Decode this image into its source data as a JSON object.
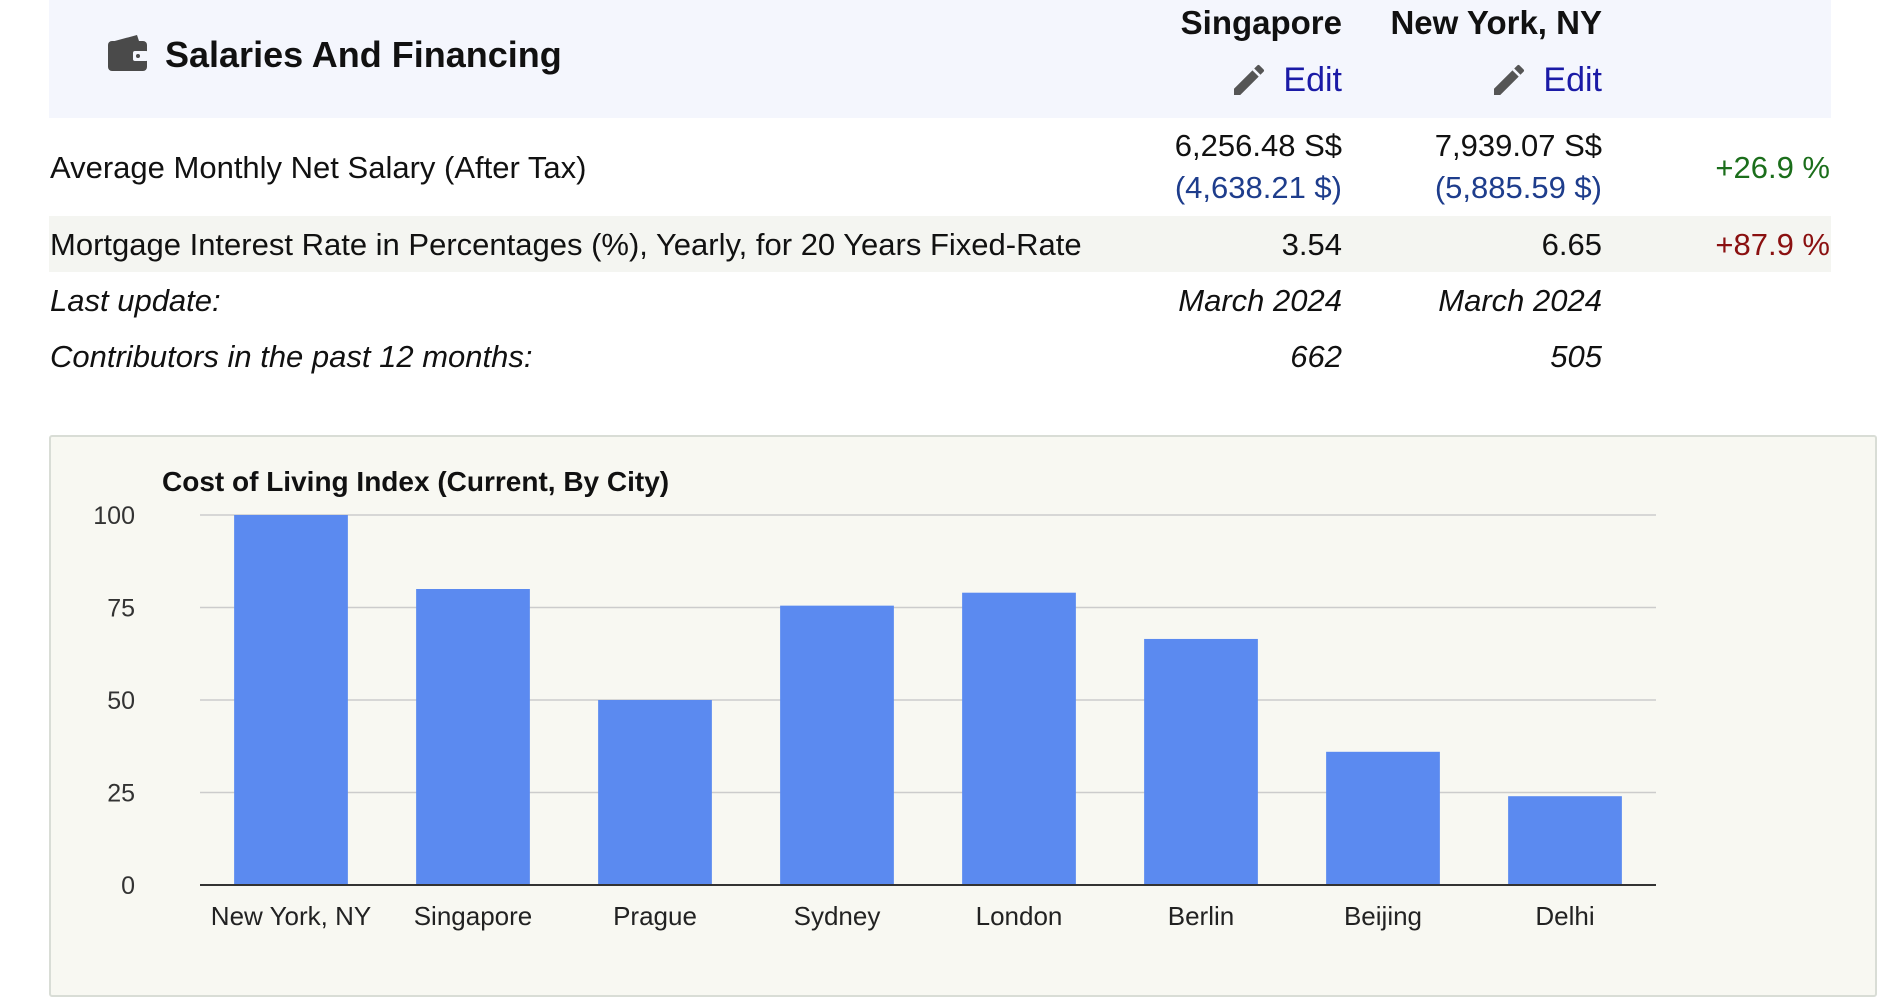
{
  "header": {
    "title": "Salaries And Financing",
    "icon": "wallet-icon",
    "cities": [
      {
        "name": "Singapore",
        "edit_label": "Edit"
      },
      {
        "name": "New York, NY",
        "edit_label": "Edit"
      }
    ]
  },
  "rows": {
    "salary": {
      "label": "Average Monthly Net Salary (After Tax)",
      "city1_local": "6,256.48 S$",
      "city1_usd": "(4,638.21 $)",
      "city2_local": "7,939.07 S$",
      "city2_usd": "(5,885.59 $)",
      "change": "+26.9 %"
    },
    "mortgage": {
      "label": "Mortgage Interest Rate in Percentages (%), Yearly, for 20 Years Fixed-Rate",
      "city1": "3.54",
      "city2": "6.65",
      "change": "+87.9 %"
    },
    "last_update": {
      "label": "Last update:",
      "city1": "March 2024",
      "city2": "March 2024"
    },
    "contributors": {
      "label": "Contributors in the past 12 months:",
      "city1": "662",
      "city2": "505"
    }
  },
  "colors": {
    "bar": "#5b8af0",
    "positive_green": "#1b6e1b",
    "positive_red": "#8a1010",
    "edit_link": "#1a1aa6"
  },
  "chart_data": {
    "type": "bar",
    "title": "Cost of Living Index (Current, By City)",
    "categories": [
      "New York, NY",
      "Singapore",
      "Prague",
      "Sydney",
      "London",
      "Berlin",
      "Beijing",
      "Delhi"
    ],
    "values": [
      100,
      80,
      50,
      75.5,
      79,
      66.5,
      36,
      24
    ],
    "ylim": [
      0,
      100
    ],
    "yticks": [
      0,
      25,
      50,
      75,
      100
    ],
    "grid": true,
    "legend": "none"
  }
}
